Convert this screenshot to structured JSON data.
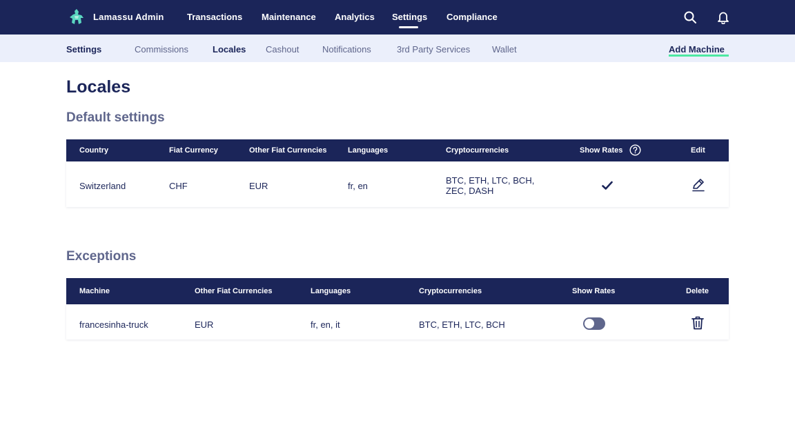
{
  "app": {
    "brand": "Lamassu Admin"
  },
  "nav": {
    "items": [
      "Transactions",
      "Maintenance",
      "Analytics",
      "Settings",
      "Compliance"
    ],
    "active": "Settings"
  },
  "subnav": {
    "items": [
      "Settings",
      "Commissions",
      "Locales",
      "Cashout",
      "Notifications",
      "3rd Party Services",
      "Wallet"
    ],
    "active": "Locales",
    "add_machine": "Add Machine"
  },
  "page": {
    "title": "Locales",
    "default_title": "Default settings",
    "exceptions_title": "Exceptions"
  },
  "default_table": {
    "headers": {
      "country": "Country",
      "fiat": "Fiat Currency",
      "other_fiat": "Other Fiat Currencies",
      "languages": "Languages",
      "crypto": "Cryptocurrencies",
      "show_rates": "Show Rates",
      "edit": "Edit"
    },
    "row": {
      "country": "Switzerland",
      "fiat": "CHF",
      "other_fiat": "EUR",
      "languages": "fr, en",
      "crypto": "BTC, ETH, LTC, BCH, ZEC, DASH",
      "show_rates": true
    }
  },
  "exceptions_table": {
    "headers": {
      "machine": "Machine",
      "other_fiat": "Other Fiat Currencies",
      "languages": "Languages",
      "crypto": "Cryptocurrencies",
      "show_rates": "Show Rates",
      "delete": "Delete"
    },
    "rows": [
      {
        "machine": "francesinha-truck",
        "other_fiat": "EUR",
        "languages": "fr, en, it",
        "crypto": "BTC, ETH, LTC, BCH",
        "show_rates": false
      }
    ]
  },
  "icons": {
    "logo": "lamassu-logo-icon",
    "search": "search-icon",
    "notifications": "bell-icon",
    "help": "help-circle-icon",
    "check": "check-icon",
    "edit": "pencil-icon",
    "delete": "trash-icon"
  },
  "colors": {
    "navy": "#1b2559",
    "accent_green": "#4ee9a2",
    "subbar_bg": "#ebeffb",
    "muted_text": "#5f668c",
    "logo_teal": "#5bd6c1"
  }
}
